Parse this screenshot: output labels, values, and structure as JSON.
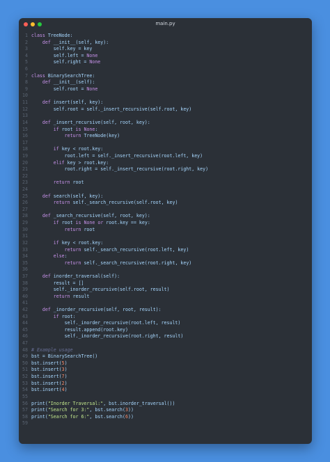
{
  "window": {
    "title": "main.py"
  },
  "colors": {
    "background": "#4a8fe0",
    "editor": "#2b3037",
    "keyword": "#c792ea",
    "text": "#a8d8ff",
    "number": "#f78c6c",
    "string": "#c3e88d",
    "comment": "#676e95"
  },
  "lines": [
    [
      [
        "kw",
        "class"
      ],
      [
        "txt",
        " TreeNode:"
      ]
    ],
    [
      [
        "txt",
        "    "
      ],
      [
        "kw",
        "def"
      ],
      [
        "txt",
        " __init__(self, key):"
      ]
    ],
    [
      [
        "txt",
        "        self.key = key"
      ]
    ],
    [
      [
        "txt",
        "        self.left = "
      ],
      [
        "kw",
        "None"
      ]
    ],
    [
      [
        "txt",
        "        self.right = "
      ],
      [
        "kw",
        "None"
      ]
    ],
    [],
    [
      [
        "kw",
        "class"
      ],
      [
        "txt",
        " BinarySearchTree:"
      ]
    ],
    [
      [
        "txt",
        "    "
      ],
      [
        "kw",
        "def"
      ],
      [
        "txt",
        " __init__(self):"
      ]
    ],
    [
      [
        "txt",
        "        self.root = "
      ],
      [
        "kw",
        "None"
      ]
    ],
    [],
    [
      [
        "txt",
        "    "
      ],
      [
        "kw",
        "def"
      ],
      [
        "txt",
        " insert(self, key):"
      ]
    ],
    [
      [
        "txt",
        "        self.root = self._insert_recursive(self.root, key)"
      ]
    ],
    [],
    [
      [
        "txt",
        "    "
      ],
      [
        "kw",
        "def"
      ],
      [
        "txt",
        " _insert_recursive(self, root, key):"
      ]
    ],
    [
      [
        "txt",
        "        "
      ],
      [
        "kw",
        "if"
      ],
      [
        "txt",
        " root "
      ],
      [
        "kw",
        "is"
      ],
      [
        "txt",
        " "
      ],
      [
        "kw",
        "None"
      ],
      [
        "txt",
        ":"
      ]
    ],
    [
      [
        "txt",
        "            "
      ],
      [
        "kw",
        "return"
      ],
      [
        "txt",
        " TreeNode(key)"
      ]
    ],
    [],
    [
      [
        "txt",
        "        "
      ],
      [
        "kw",
        "if"
      ],
      [
        "txt",
        " key < root.key:"
      ]
    ],
    [
      [
        "txt",
        "            root.left = self._insert_recursive(root.left, key)"
      ]
    ],
    [
      [
        "txt",
        "        "
      ],
      [
        "kw",
        "elif"
      ],
      [
        "txt",
        " key > root.key:"
      ]
    ],
    [
      [
        "txt",
        "            root.right = self._insert_recursive(root.right, key)"
      ]
    ],
    [],
    [
      [
        "txt",
        "        "
      ],
      [
        "kw",
        "return"
      ],
      [
        "txt",
        " root"
      ]
    ],
    [],
    [
      [
        "txt",
        "    "
      ],
      [
        "kw",
        "def"
      ],
      [
        "txt",
        " search(self, key):"
      ]
    ],
    [
      [
        "txt",
        "        "
      ],
      [
        "kw",
        "return"
      ],
      [
        "txt",
        " self._search_recursive(self.root, key)"
      ]
    ],
    [],
    [
      [
        "txt",
        "    "
      ],
      [
        "kw",
        "def"
      ],
      [
        "txt",
        " _search_recursive(self, root, key):"
      ]
    ],
    [
      [
        "txt",
        "        "
      ],
      [
        "kw",
        "if"
      ],
      [
        "txt",
        " root "
      ],
      [
        "kw",
        "is"
      ],
      [
        "txt",
        " "
      ],
      [
        "kw",
        "None"
      ],
      [
        "txt",
        " "
      ],
      [
        "kw",
        "or"
      ],
      [
        "txt",
        " root.key == key:"
      ]
    ],
    [
      [
        "txt",
        "            "
      ],
      [
        "kw",
        "return"
      ],
      [
        "txt",
        " root"
      ]
    ],
    [],
    [
      [
        "txt",
        "        "
      ],
      [
        "kw",
        "if"
      ],
      [
        "txt",
        " key < root.key:"
      ]
    ],
    [
      [
        "txt",
        "            "
      ],
      [
        "kw",
        "return"
      ],
      [
        "txt",
        " self._search_recursive(root.left, key)"
      ]
    ],
    [
      [
        "txt",
        "        "
      ],
      [
        "kw",
        "else"
      ],
      [
        "txt",
        ":"
      ]
    ],
    [
      [
        "txt",
        "            "
      ],
      [
        "kw",
        "return"
      ],
      [
        "txt",
        " self._search_recursive(root.right, key)"
      ]
    ],
    [],
    [
      [
        "txt",
        "    "
      ],
      [
        "kw",
        "def"
      ],
      [
        "txt",
        " inorder_traversal(self):"
      ]
    ],
    [
      [
        "txt",
        "        result = []"
      ]
    ],
    [
      [
        "txt",
        "        self._inorder_recursive(self.root, result)"
      ]
    ],
    [
      [
        "txt",
        "        "
      ],
      [
        "kw",
        "return"
      ],
      [
        "txt",
        " result"
      ]
    ],
    [],
    [
      [
        "txt",
        "    "
      ],
      [
        "kw",
        "def"
      ],
      [
        "txt",
        " _inorder_recursive(self, root, result):"
      ]
    ],
    [
      [
        "txt",
        "        "
      ],
      [
        "kw",
        "if"
      ],
      [
        "txt",
        " root:"
      ]
    ],
    [
      [
        "txt",
        "            self._inorder_recursive(root.left, result)"
      ]
    ],
    [
      [
        "txt",
        "            result.append(root.key)"
      ]
    ],
    [
      [
        "txt",
        "            self._inorder_recursive(root.right, result)"
      ]
    ],
    [],
    [
      [
        "cm",
        "# Example usage"
      ]
    ],
    [
      [
        "txt",
        "bst = BinarySearchTree()"
      ]
    ],
    [
      [
        "txt",
        "bst.insert("
      ],
      [
        "num",
        "5"
      ],
      [
        "txt",
        ")"
      ]
    ],
    [
      [
        "txt",
        "bst.insert("
      ],
      [
        "num",
        "3"
      ],
      [
        "txt",
        ")"
      ]
    ],
    [
      [
        "txt",
        "bst.insert("
      ],
      [
        "num",
        "7"
      ],
      [
        "txt",
        ")"
      ]
    ],
    [
      [
        "txt",
        "bst.insert("
      ],
      [
        "num",
        "2"
      ],
      [
        "txt",
        ")"
      ]
    ],
    [
      [
        "txt",
        "bst.insert("
      ],
      [
        "num",
        "4"
      ],
      [
        "txt",
        ")"
      ]
    ],
    [],
    [
      [
        "txt",
        "print("
      ],
      [
        "str",
        "\"Inorder Traversal:\""
      ],
      [
        "txt",
        ", bst.inorder_traversal())"
      ]
    ],
    [
      [
        "txt",
        "print("
      ],
      [
        "str",
        "\"Search for 3:\""
      ],
      [
        "txt",
        ", bst.search("
      ],
      [
        "num",
        "3"
      ],
      [
        "txt",
        "))"
      ]
    ],
    [
      [
        "txt",
        "print("
      ],
      [
        "str",
        "\"Search for 6:\""
      ],
      [
        "txt",
        ", bst.search("
      ],
      [
        "num",
        "6"
      ],
      [
        "txt",
        "))"
      ]
    ],
    []
  ]
}
